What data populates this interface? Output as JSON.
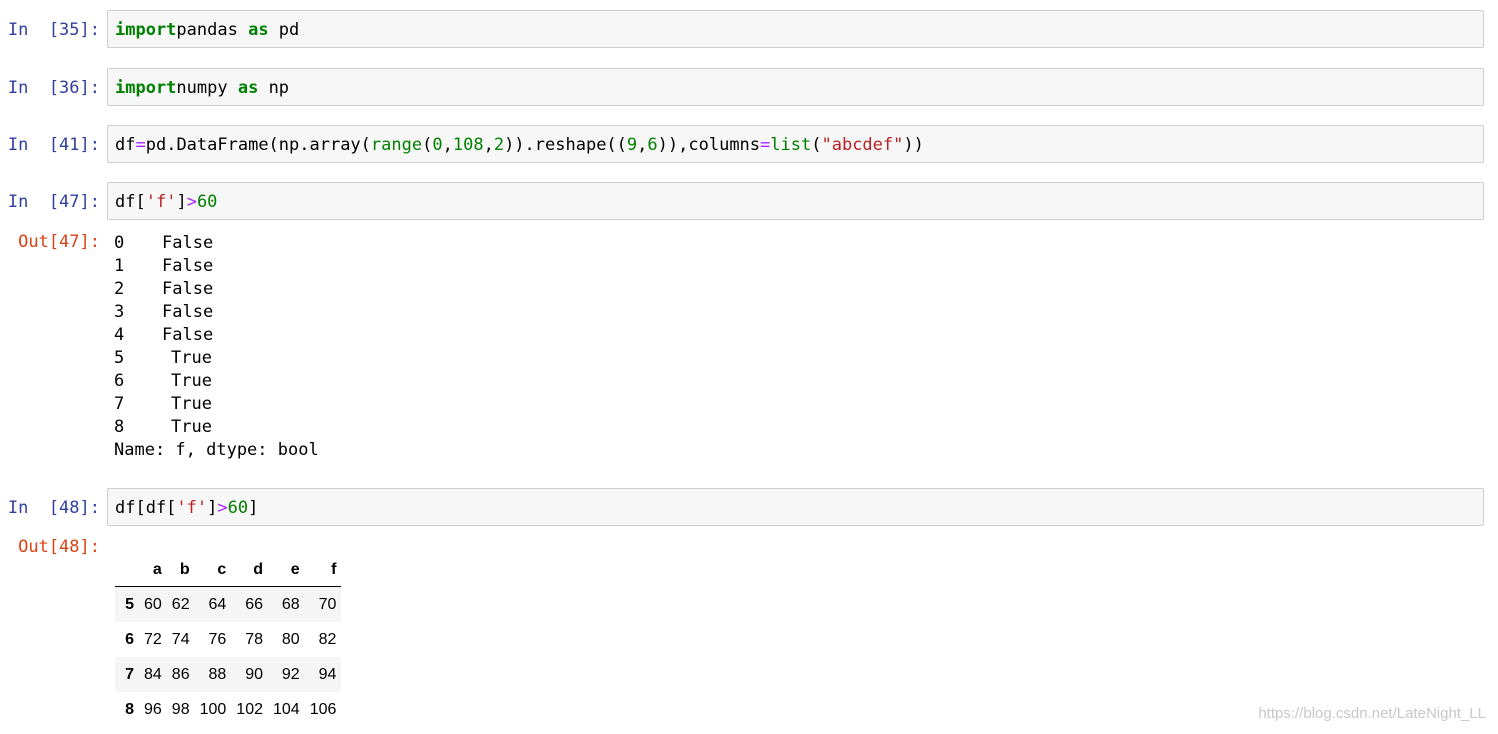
{
  "cells": [
    {
      "prompt": "In  [35]:",
      "tokens": [
        [
          "kw",
          "import"
        ],
        [
          "",
          "pandas "
        ],
        [
          "kw",
          "as"
        ],
        [
          "",
          " pd"
        ]
      ]
    },
    {
      "prompt": "In  [36]:",
      "tokens": [
        [
          "kw",
          "import"
        ],
        [
          "",
          "numpy "
        ],
        [
          "kw",
          "as"
        ],
        [
          "",
          " np"
        ]
      ]
    },
    {
      "prompt": "In  [41]:",
      "tokens": [
        [
          "",
          "df"
        ],
        [
          "op",
          "="
        ],
        [
          "",
          "pd.DataFrame(np.array("
        ],
        [
          "bi",
          "range"
        ],
        [
          "",
          "("
        ],
        [
          "num",
          "0"
        ],
        [
          "",
          ","
        ],
        [
          "num",
          "108"
        ],
        [
          "",
          ","
        ],
        [
          "num",
          "2"
        ],
        [
          "",
          "))"
        ],
        [
          "",
          ".reshape(("
        ],
        [
          "num",
          "9"
        ],
        [
          "",
          ","
        ],
        [
          "num",
          "6"
        ],
        [
          "",
          "))"
        ],
        [
          "",
          ",columns"
        ],
        [
          "op",
          "="
        ],
        [
          "bi",
          "list"
        ],
        [
          "",
          "("
        ],
        [
          "str",
          "\"abcdef\""
        ],
        [
          "",
          "))"
        ]
      ]
    },
    {
      "prompt": "In  [47]:",
      "tokens": [
        [
          "",
          "df["
        ],
        [
          "str",
          "'f'"
        ],
        [
          "",
          "]"
        ],
        [
          "op",
          ">"
        ],
        [
          "num",
          "60"
        ]
      ]
    },
    {
      "prompt": "In  [48]:",
      "tokens": [
        [
          "",
          "df[df["
        ],
        [
          "str",
          "'f'"
        ],
        [
          "",
          "]"
        ],
        [
          "op",
          ">"
        ],
        [
          "num",
          "60"
        ],
        [
          "",
          "]"
        ]
      ]
    }
  ],
  "out47": {
    "prompt": "Out[47]:",
    "rows": [
      {
        "index": "0",
        "value": "False"
      },
      {
        "index": "1",
        "value": "False"
      },
      {
        "index": "2",
        "value": "False"
      },
      {
        "index": "3",
        "value": "False"
      },
      {
        "index": "4",
        "value": "False"
      },
      {
        "index": "5",
        "value": "True"
      },
      {
        "index": "6",
        "value": "True"
      },
      {
        "index": "7",
        "value": "True"
      },
      {
        "index": "8",
        "value": "True"
      }
    ],
    "footer": "Name: f, dtype: bool"
  },
  "out48": {
    "prompt": "Out[48]:",
    "columns": [
      "a",
      "b",
      "c",
      "d",
      "e",
      "f"
    ],
    "rows": [
      {
        "index": "5",
        "values": [
          "60",
          "62",
          "64",
          "66",
          "68",
          "70"
        ]
      },
      {
        "index": "6",
        "values": [
          "72",
          "74",
          "76",
          "78",
          "80",
          "82"
        ]
      },
      {
        "index": "7",
        "values": [
          "84",
          "86",
          "88",
          "90",
          "92",
          "94"
        ]
      },
      {
        "index": "8",
        "values": [
          "96",
          "98",
          "100",
          "102",
          "104",
          "106"
        ]
      }
    ]
  },
  "watermark": "https://blog.csdn.net/LateNight_LL"
}
